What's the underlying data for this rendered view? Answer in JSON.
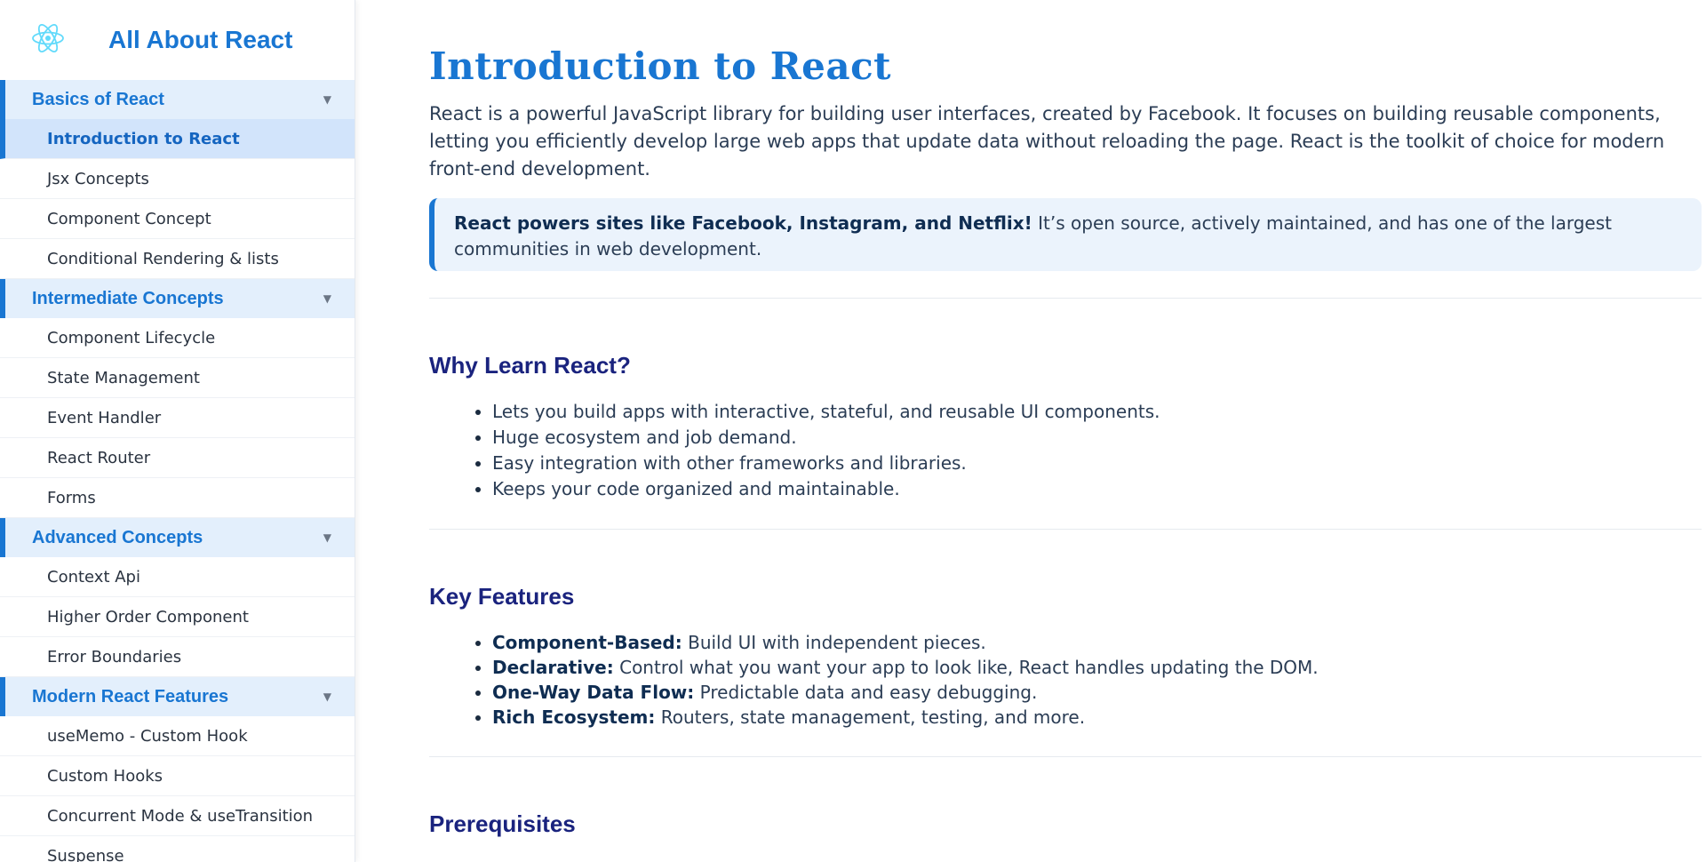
{
  "sidebar": {
    "brand_title": "All About React",
    "logo_icon": "react-atom-icon",
    "accent_color": "#1976d2",
    "sections": [
      {
        "title": "Basics of React",
        "items": [
          {
            "label": "Introduction to React",
            "active": true
          },
          {
            "label": "Jsx Concepts"
          },
          {
            "label": "Component Concept"
          },
          {
            "label": "Conditional Rendering & lists"
          }
        ]
      },
      {
        "title": "Intermediate Concepts",
        "items": [
          {
            "label": "Component Lifecycle"
          },
          {
            "label": "State Management"
          },
          {
            "label": "Event Handler"
          },
          {
            "label": "React Router"
          },
          {
            "label": "Forms"
          }
        ]
      },
      {
        "title": "Advanced Concepts",
        "items": [
          {
            "label": "Context Api"
          },
          {
            "label": "Higher Order Component"
          },
          {
            "label": "Error Boundaries"
          }
        ]
      },
      {
        "title": "Modern React Features",
        "items": [
          {
            "label": "useMemo - Custom Hook"
          },
          {
            "label": "Custom Hooks"
          },
          {
            "label": "Concurrent Mode & useTransition"
          },
          {
            "label": "Suspense"
          }
        ]
      }
    ]
  },
  "main": {
    "title": "Introduction to React",
    "intro": "React is a powerful JavaScript library for building user interfaces, created by Facebook. It focuses on building reusable components, letting you efficiently develop large web apps that update data without reloading the page. React is the toolkit of choice for modern front-end development.",
    "callout": {
      "bold": "React powers sites like Facebook, Instagram, and Netflix!",
      "text": " It’s open source, actively maintained, and has one of the largest communities in web development."
    },
    "why": {
      "title": "Why Learn React?",
      "items": [
        "Lets you build apps with interactive, stateful, and reusable UI components.",
        "Huge ecosystem and job demand.",
        "Easy integration with other frameworks and libraries.",
        "Keeps your code organized and maintainable."
      ]
    },
    "features": {
      "title": "Key Features",
      "items": [
        {
          "term": "Component-Based:",
          "desc": " Build UI with independent pieces."
        },
        {
          "term": "Declarative:",
          "desc": " Control what you want your app to look like, React handles updating the DOM."
        },
        {
          "term": "One-Way Data Flow:",
          "desc": " Predictable data and easy debugging."
        },
        {
          "term": "Rich Ecosystem:",
          "desc": " Routers, state management, testing, and more."
        }
      ]
    },
    "prerequisites": {
      "title": "Prerequisites"
    }
  }
}
